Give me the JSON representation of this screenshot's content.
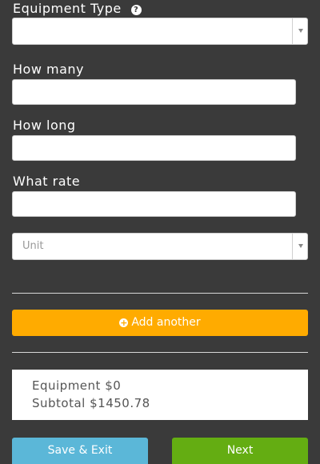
{
  "form": {
    "equipment_type_label": "Equipment Type",
    "equipment_type_value": "",
    "how_many_label": "How many",
    "how_many_value": "",
    "how_long_label": "How long",
    "how_long_value": "",
    "what_rate_label": "What rate",
    "what_rate_value": "",
    "unit_placeholder": "Unit",
    "help_icon": "question-circle-icon",
    "dropdown_icon": "chevron-down-icon"
  },
  "actions": {
    "add_another_label": "Add another",
    "add_icon": "plus-circle-icon",
    "save_exit_label": "Save & Exit",
    "next_label": "Next"
  },
  "summary": {
    "equipment_line": "Equipment $0",
    "subtotal_line": "Subtotal $1450.78"
  },
  "colors": {
    "background": "#3a3a3a",
    "add_button": "#ffab00",
    "save_button": "#5bb7d8",
    "next_button": "#64ad12"
  }
}
